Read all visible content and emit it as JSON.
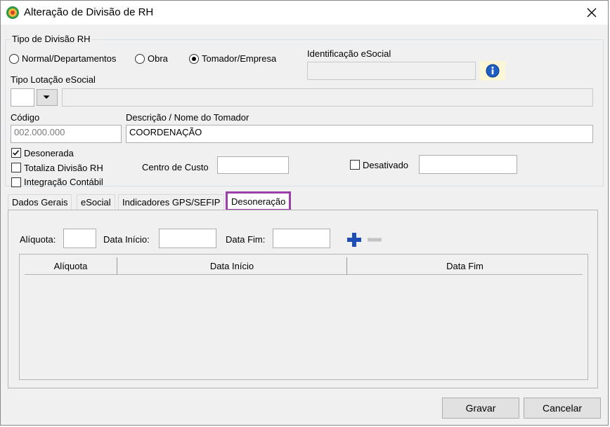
{
  "window": {
    "title": "Alteração de Divisão de RH"
  },
  "tipo_divisao": {
    "group_label": "Tipo de Divisão RH",
    "options": [
      "Normal/Departamentos",
      "Obra",
      "Tomador/Empresa"
    ],
    "selected": "Tomador/Empresa"
  },
  "identificacao": {
    "label": "Identificação eSocial",
    "value": ""
  },
  "tipo_lotacao": {
    "label": "Tipo Lotação eSocial",
    "code": "",
    "description": ""
  },
  "codigo": {
    "label": "Código",
    "value": "002.000.000"
  },
  "descricao": {
    "label": "Descrição / Nome do Tomador",
    "value": "COORDENAÇÃO"
  },
  "checks": {
    "desonerada": {
      "label": "Desonerada",
      "checked": true
    },
    "totaliza": {
      "label": "Totaliza Divisão RH",
      "checked": false
    },
    "integracao": {
      "label": "Integração Contábil",
      "checked": false
    },
    "desativado": {
      "label": "Desativado",
      "checked": false
    }
  },
  "centro_custo": {
    "label": "Centro de Custo",
    "value": ""
  },
  "desativado_value": "",
  "tabs": [
    {
      "label": "Dados Gerais",
      "active": false
    },
    {
      "label": "eSocial",
      "active": false
    },
    {
      "label": "Indicadores GPS/SEFIP",
      "active": false
    },
    {
      "label": "Desoneração",
      "active": true
    }
  ],
  "desoneracao": {
    "aliquota_label": "Alíquota:",
    "aliquota_value": "",
    "data_inicio_label": "Data Início:",
    "data_inicio_value": "",
    "data_fim_label": "Data Fim:",
    "data_fim_value": "",
    "add_icon": "plus-icon",
    "remove_icon": "minus-icon",
    "columns": [
      "Alíquota",
      "Data Início",
      "Data Fim"
    ],
    "rows": []
  },
  "buttons": {
    "gravar": "Gravar",
    "cancelar": "Cancelar"
  },
  "colors": {
    "highlight": "#9b3fa8",
    "plus": "#1f4fb4",
    "info": "#1f5fc4"
  }
}
